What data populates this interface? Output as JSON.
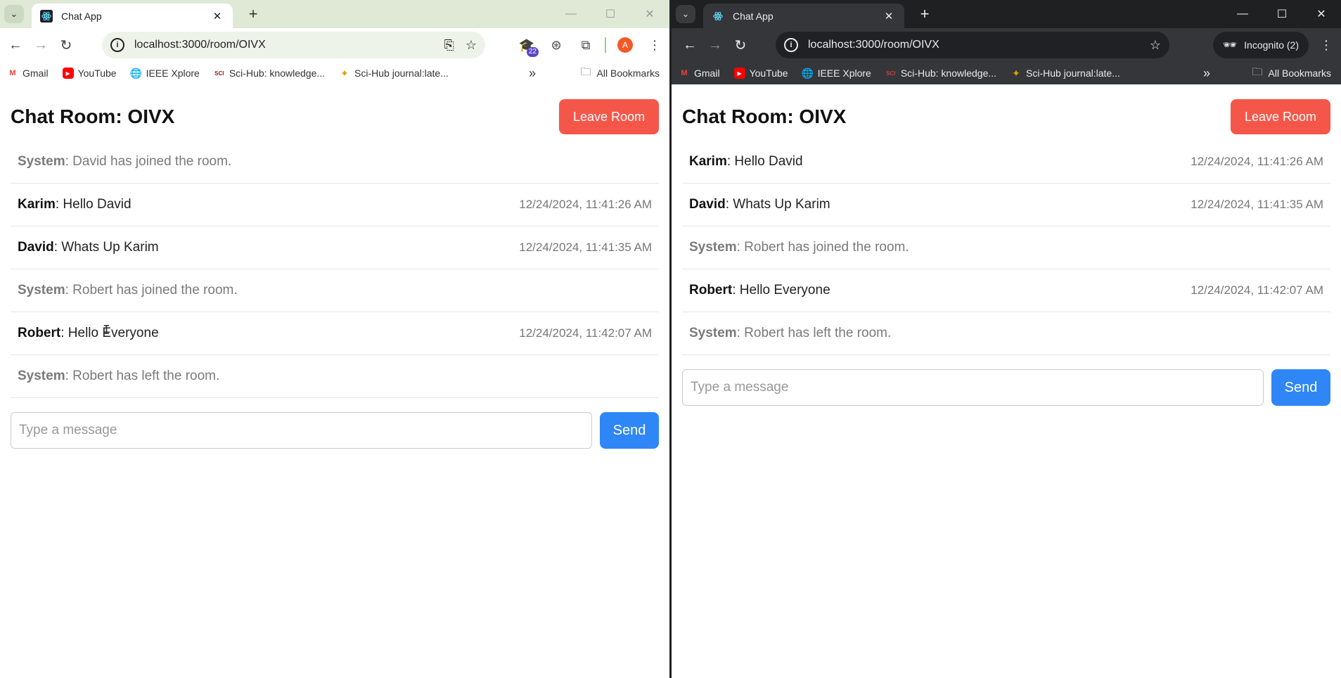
{
  "left": {
    "tab": {
      "title": "Chat App"
    },
    "url": "localhost:3000/room/OIVX",
    "extension_badge": "22",
    "profile_initial": "A",
    "bookmarks": [
      {
        "label": "Gmail",
        "icon": "gmail-icon"
      },
      {
        "label": "YouTube",
        "icon": "youtube-icon"
      },
      {
        "label": "IEEE Xplore",
        "icon": "globe-icon"
      },
      {
        "label": "Sci-Hub: knowledge...",
        "icon": "scihub-icon"
      },
      {
        "label": "Sci-Hub journal:late...",
        "icon": "scihub-raven-icon"
      }
    ],
    "all_bookmarks": "All Bookmarks",
    "app": {
      "room_title": "Chat Room: OIVX",
      "leave_label": "Leave Room",
      "messages": [
        {
          "type": "system",
          "sender": "System",
          "text": ": David has joined the room.",
          "time": ""
        },
        {
          "type": "user",
          "sender": "Karim",
          "text": ": Hello David",
          "time": "12/24/2024, 11:41:26 AM"
        },
        {
          "type": "user",
          "sender": "David",
          "text": ": Whats Up Karim",
          "time": "12/24/2024, 11:41:35 AM"
        },
        {
          "type": "system",
          "sender": "System",
          "text": ": Robert has joined the room.",
          "time": ""
        },
        {
          "type": "user",
          "sender": "Robert",
          "text": ": Hello Everyone",
          "time": "12/24/2024, 11:42:07 AM"
        },
        {
          "type": "system",
          "sender": "System",
          "text": ": Robert has left the room.",
          "time": ""
        }
      ],
      "input_placeholder": "Type a message",
      "input_value": "",
      "send_label": "Send"
    }
  },
  "right": {
    "tab": {
      "title": "Chat App"
    },
    "url": "localhost:3000/room/OIVX",
    "incognito_label": "Incognito (2)",
    "bookmarks": [
      {
        "label": "Gmail",
        "icon": "gmail-icon"
      },
      {
        "label": "YouTube",
        "icon": "youtube-icon"
      },
      {
        "label": "IEEE Xplore",
        "icon": "globe-icon"
      },
      {
        "label": "Sci-Hub: knowledge...",
        "icon": "scihub-icon"
      },
      {
        "label": "Sci-Hub journal:late...",
        "icon": "scihub-raven-icon"
      }
    ],
    "all_bookmarks": "All Bookmarks",
    "app": {
      "room_title": "Chat Room: OIVX",
      "leave_label": "Leave Room",
      "messages": [
        {
          "type": "user",
          "sender": "Karim",
          "text": ": Hello David",
          "time": "12/24/2024, 11:41:26 AM"
        },
        {
          "type": "user",
          "sender": "David",
          "text": ": Whats Up Karim",
          "time": "12/24/2024, 11:41:35 AM"
        },
        {
          "type": "system",
          "sender": "System",
          "text": ": Robert has joined the room.",
          "time": ""
        },
        {
          "type": "user",
          "sender": "Robert",
          "text": ": Hello Everyone",
          "time": "12/24/2024, 11:42:07 AM"
        },
        {
          "type": "system",
          "sender": "System",
          "text": ": Robert has left the room.",
          "time": ""
        }
      ],
      "input_placeholder": "Type a message",
      "input_value": "",
      "send_label": "Send"
    }
  },
  "colors": {
    "leave_button": "#f4574a",
    "send_button": "#2f86f6",
    "system_text": "#7a7a7a",
    "light_chrome": "#dfe9d6",
    "dark_chrome": "#1f2021"
  }
}
